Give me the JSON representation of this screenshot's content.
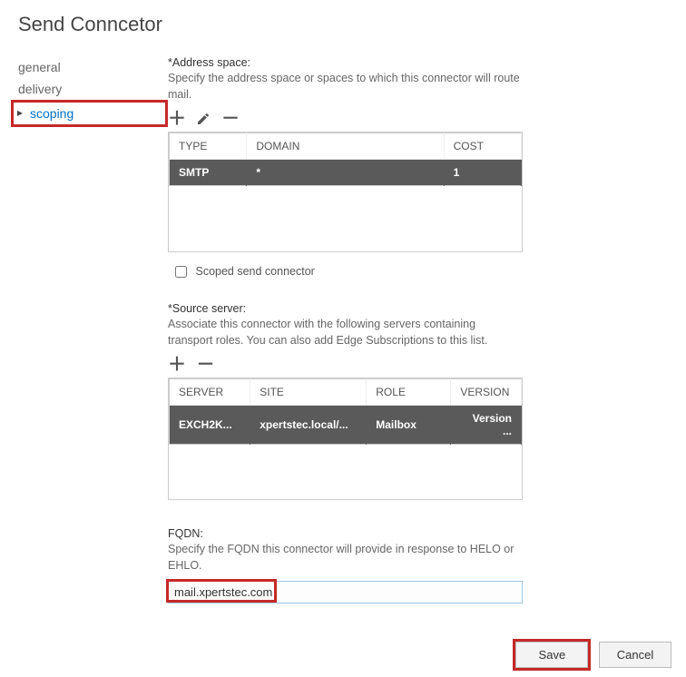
{
  "header": {
    "title": "Send Conncetor"
  },
  "sidebar": {
    "items": [
      {
        "label": "general"
      },
      {
        "label": "delivery"
      },
      {
        "label": "scoping"
      }
    ]
  },
  "addressSpace": {
    "label": "*Address space:",
    "help": "Specify the address space or spaces to which this connector will route mail.",
    "columns": {
      "type": "TYPE",
      "domain": "DOMAIN",
      "cost": "COST"
    },
    "row": {
      "type": "SMTP",
      "domain": "*",
      "cost": "1"
    }
  },
  "scoped": {
    "label": "Scoped send connector"
  },
  "sourceServer": {
    "label": "*Source server:",
    "help": "Associate this connector with the following servers containing transport roles. You can also add Edge Subscriptions to this list.",
    "columns": {
      "server": "SERVER",
      "site": "SITE",
      "role": "ROLE",
      "version": "VERSION"
    },
    "row": {
      "server": "EXCH2K...",
      "site": "xpertstec.local/...",
      "role": "Mailbox",
      "version": "Version ..."
    }
  },
  "fqdn": {
    "label": "FQDN:",
    "help": "Specify the FQDN this connector will provide in response to HELO or EHLO.",
    "value": "mail.xpertstec.com"
  },
  "footer": {
    "save": "Save",
    "cancel": "Cancel"
  },
  "icons": {
    "plus": "＋",
    "minus": "－"
  }
}
